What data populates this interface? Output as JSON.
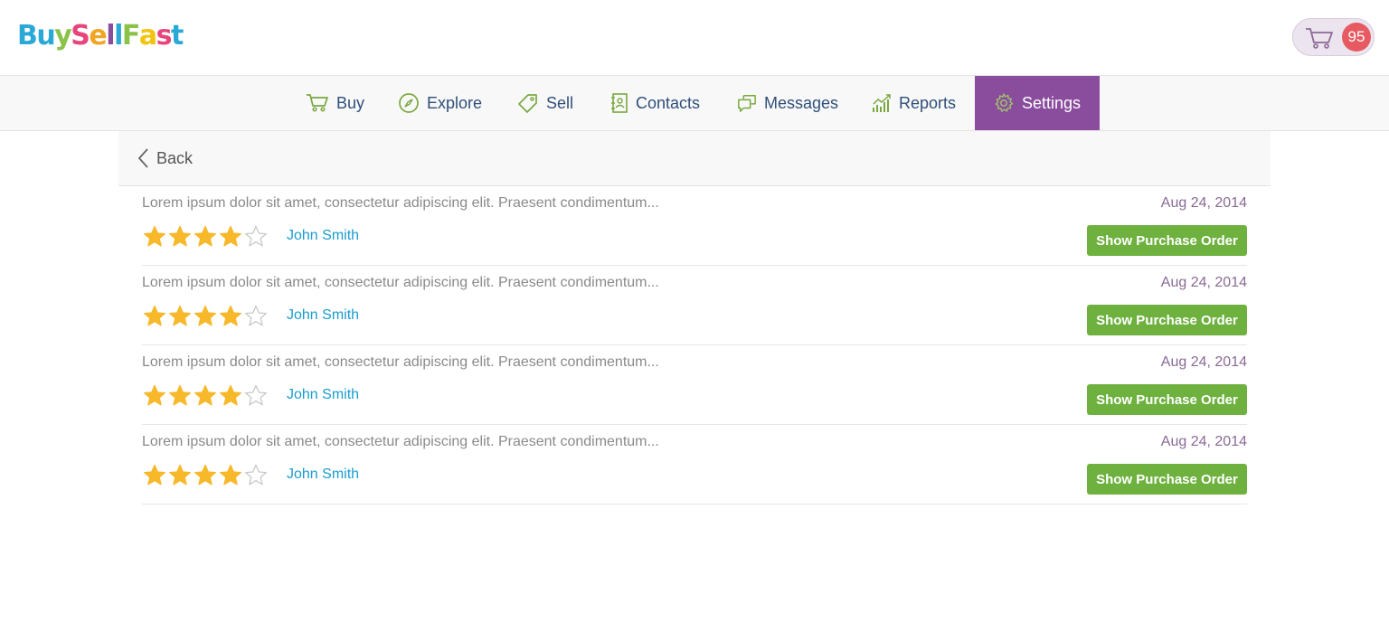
{
  "header": {
    "logo_letters": [
      {
        "ch": "B",
        "color": "#2aa8d6"
      },
      {
        "ch": "u",
        "color": "#2aa8d6"
      },
      {
        "ch": "y",
        "color": "#8bc34a"
      },
      {
        "ch": "S",
        "color": "#e8457c"
      },
      {
        "ch": "e",
        "color": "#f1a623"
      },
      {
        "ch": "l",
        "color": "#8a4d9e"
      },
      {
        "ch": "l",
        "color": "#2aa8d6"
      },
      {
        "ch": "F",
        "color": "#8bc34a"
      },
      {
        "ch": "a",
        "color": "#f1c40f"
      },
      {
        "ch": "s",
        "color": "#e8457c"
      },
      {
        "ch": "t",
        "color": "#2aa8d6"
      }
    ],
    "cart_count": "95"
  },
  "nav": {
    "items": [
      {
        "label": "Buy",
        "icon": "cart-icon"
      },
      {
        "label": "Explore",
        "icon": "compass-icon"
      },
      {
        "label": "Sell",
        "icon": "tag-icon"
      },
      {
        "label": "Contacts",
        "icon": "address-book-icon"
      },
      {
        "label": "Messages",
        "icon": "chat-icon"
      },
      {
        "label": "Reports",
        "icon": "bar-chart-icon"
      },
      {
        "label": "Settings",
        "icon": "gear-icon",
        "active": true
      }
    ]
  },
  "back_label": "Back",
  "reviews": [
    {
      "text": "Lorem ipsum dolor sit amet, consectetur adipiscing elit. Praesent condimentum...",
      "date": "Aug 24, 2014",
      "rating": 4,
      "author": "John Smith",
      "button": "Show Purchase Order"
    },
    {
      "text": "Lorem ipsum dolor sit amet, consectetur adipiscing elit. Praesent condimentum...",
      "date": "Aug 24, 2014",
      "rating": 4,
      "author": "John Smith",
      "button": "Show Purchase Order"
    },
    {
      "text": "Lorem ipsum dolor sit amet, consectetur adipiscing elit. Praesent condimentum...",
      "date": "Aug 24, 2014",
      "rating": 4,
      "author": "John Smith",
      "button": "Show Purchase Order"
    },
    {
      "text": "Lorem ipsum dolor sit amet, consectetur adipiscing elit. Praesent condimentum...",
      "date": "Aug 24, 2014",
      "rating": 4,
      "author": "John Smith",
      "button": "Show Purchase Order"
    }
  ],
  "colors": {
    "accent": "#8a4d9e",
    "button": "#6eb13f",
    "link": "#1a9ccf",
    "star": "#f7b82a",
    "badge": "#e75a62"
  }
}
